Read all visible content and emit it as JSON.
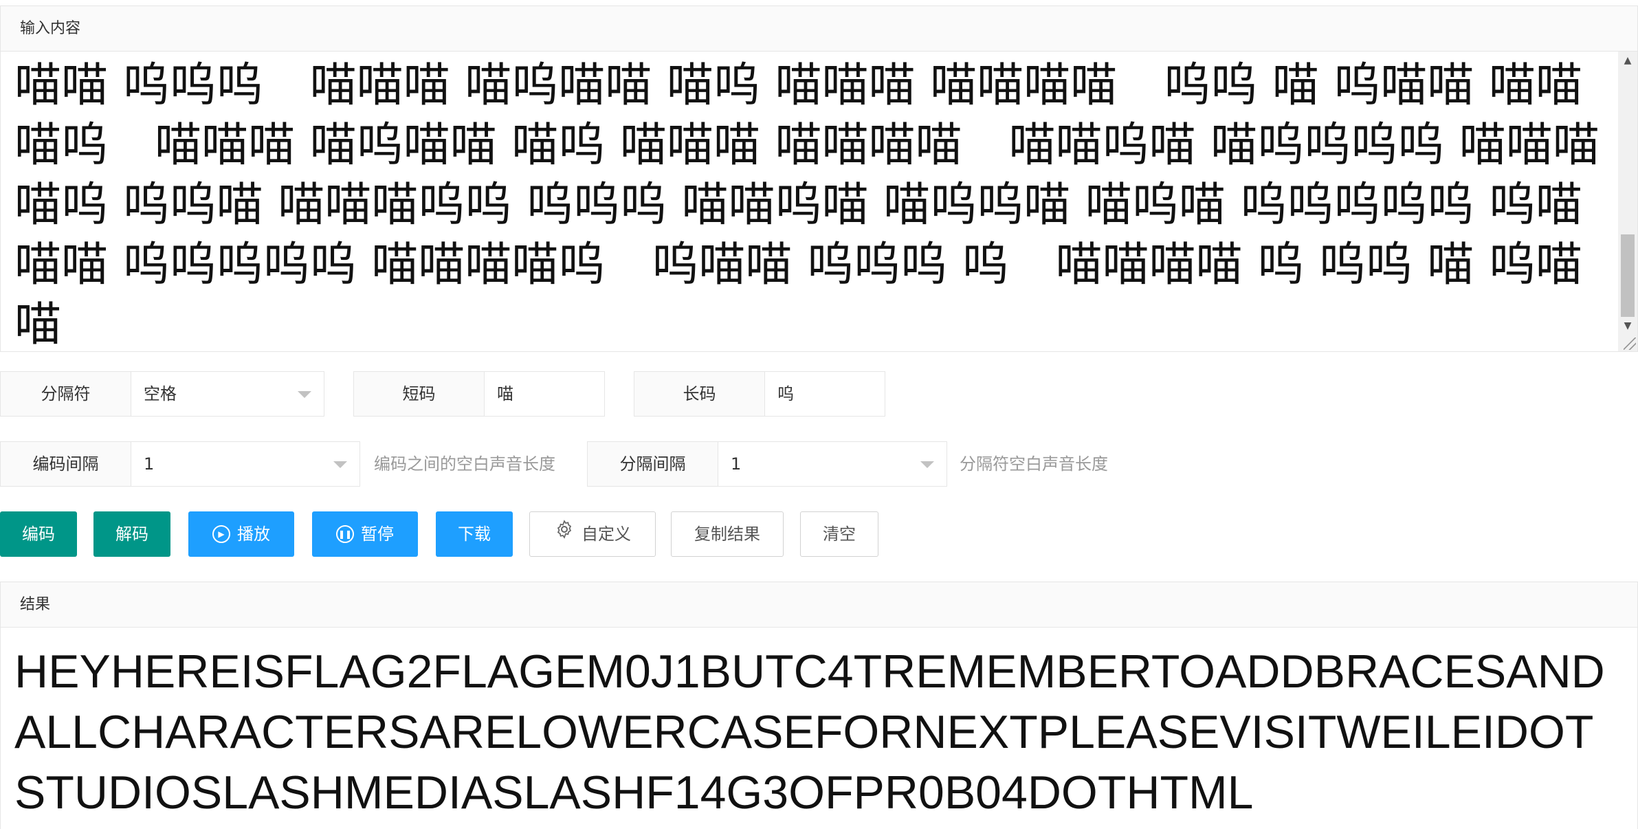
{
  "input_panel": {
    "title": "输入内容",
    "content": "喵喵 呜呜呜　喵喵喵 喵呜喵喵 喵呜 喵喵喵 喵喵喵喵　呜呜 喵 呜喵喵 喵喵喵呜　喵喵喵 喵呜喵喵 喵呜 喵喵喵 喵喵喵喵　喵喵呜喵 喵呜呜呜呜 喵喵喵喵呜 呜呜喵 喵喵喵呜呜 呜呜呜 喵喵呜喵 喵呜呜喵 喵呜喵 呜呜呜呜呜 呜喵喵喵 呜呜呜呜呜 喵喵喵喵呜　呜喵喵 呜呜呜 呜　喵喵喵喵 呜 呜呜 喵 呜喵喵"
  },
  "options": {
    "separator": {
      "label": "分隔符",
      "value": "空格"
    },
    "short_code": {
      "label": "短码",
      "value": "喵"
    },
    "long_code": {
      "label": "长码",
      "value": "呜"
    },
    "code_interval": {
      "label": "编码间隔",
      "value": "1",
      "hint": "编码之间的空白声音长度"
    },
    "separator_interval": {
      "label": "分隔间隔",
      "value": "1",
      "hint": "分隔符空白声音长度"
    }
  },
  "buttons": {
    "encode": "编码",
    "decode": "解码",
    "play": "播放",
    "pause": "暂停",
    "download": "下载",
    "customize": "自定义",
    "copy_result": "复制结果",
    "clear": "清空"
  },
  "result_panel": {
    "title": "结果",
    "content": "HEYHEREISFLAG2FLAGEM0J1BUTC4TREMEMBERTOADDBRACESANDALLCHARACTERSARELOWERCASEFORNEXTPLEASEVISITWEILEIDOTSTUDIOSLASHMEDIASLASHF14G3OFPR0B04DOTHTML"
  },
  "colors": {
    "primary_green": "#009688",
    "primary_blue": "#1e9fff",
    "border": "#e6e6e6",
    "hint_text": "#999999"
  },
  "icons": {
    "play": "play-icon",
    "pause": "pause-icon",
    "customize": "gear-icon",
    "select_caret": "chevron-down-icon"
  }
}
